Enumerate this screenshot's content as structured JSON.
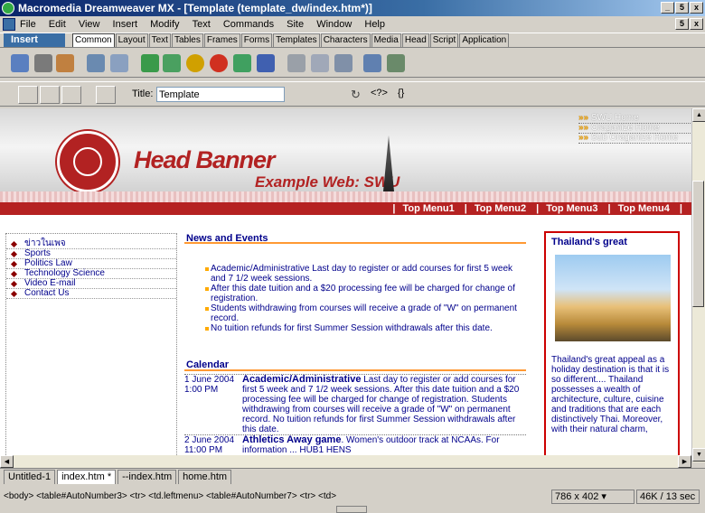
{
  "window": {
    "title": "Macromedia Dreamweaver MX - [Template (template_dw/index.htm*)]",
    "min": "_",
    "restore": "5",
    "close": "x"
  },
  "menu": [
    "File",
    "Edit",
    "View",
    "Insert",
    "Modify",
    "Text",
    "Commands",
    "Site",
    "Window",
    "Help"
  ],
  "insert_bar": {
    "label": "Insert",
    "tabs": [
      "Common",
      "Layout",
      "Text",
      "Tables",
      "Frames",
      "Forms",
      "Templates",
      "Characters",
      "Media",
      "Head",
      "Script",
      "Application"
    ],
    "active": "Common"
  },
  "doc_toolbar": {
    "title_label": "Title:",
    "title_value": "Template",
    "symbols": [
      "<?>",
      "{}"
    ]
  },
  "banner": {
    "title": "Head Banner",
    "subtitle": "Example Web: SWU",
    "top_links": [
      "SWU Home",
      "Oraganize Home",
      "Sub Oraganize Home"
    ],
    "top_menu": [
      "Top Menu1",
      "Top Menu2",
      "Top Menu3",
      "Top Menu4"
    ]
  },
  "left_nav": [
    "ข่าวในเพจ",
    "Sports",
    "Politics Law",
    "Technology Science",
    "Video E-mail",
    "Contact Us"
  ],
  "news": {
    "title": "News and Events",
    "items": [
      "Academic/Administrative Last day to register or add courses for first 5 week and 7 1/2 week sessions.",
      "After this date tuition and a $20 processing fee will be charged for change of registration.",
      "Students withdrawing from courses will receive a grade of \"W\" on permanent record.",
      "No tuition refunds for first Summer Session withdrawals after this date."
    ]
  },
  "calendar": {
    "title": "Calendar",
    "rows": [
      {
        "date": "1 June 2004 1:00 PM",
        "head": "Academic/Administrative",
        "text": " Last day to register or add courses for first 5 week and 7 1/2 week sessions. After this date tuition and a $20 processing fee will be charged for change of registration. Students withdrawing from courses will receive a grade of \"W\" on permanent record. No tuition refunds for first Summer Session withdrawals after this date."
      },
      {
        "date": "2 June 2004 11:00 PM",
        "head": "Athletics Away game",
        "text": ". Women's outdoor track at NCAAs. For information ... HUB1 HENS"
      }
    ]
  },
  "sidebar_box": {
    "title": "Thailand's great",
    "text": "Thailand's great appeal as a holiday destination is that it is so different.... Thailand possesses a wealth of architecture, culture, cuisine and traditions that are each distinctively Thai. Moreover, with their natural charm,"
  },
  "tabs": [
    "Untitled-1",
    "index.htm *",
    "--index.htm",
    "home.htm"
  ],
  "status": {
    "path": "<body> <table#AutoNumber3> <tr> <td.leftmenu> <table#AutoNumber7> <tr> <td>",
    "size": "786 x 402",
    "weight": "46K / 13 sec"
  },
  "colors": {
    "brand_red": "#b22222",
    "nav_blue": "#00008b",
    "accent_orange": "#ff9933"
  }
}
